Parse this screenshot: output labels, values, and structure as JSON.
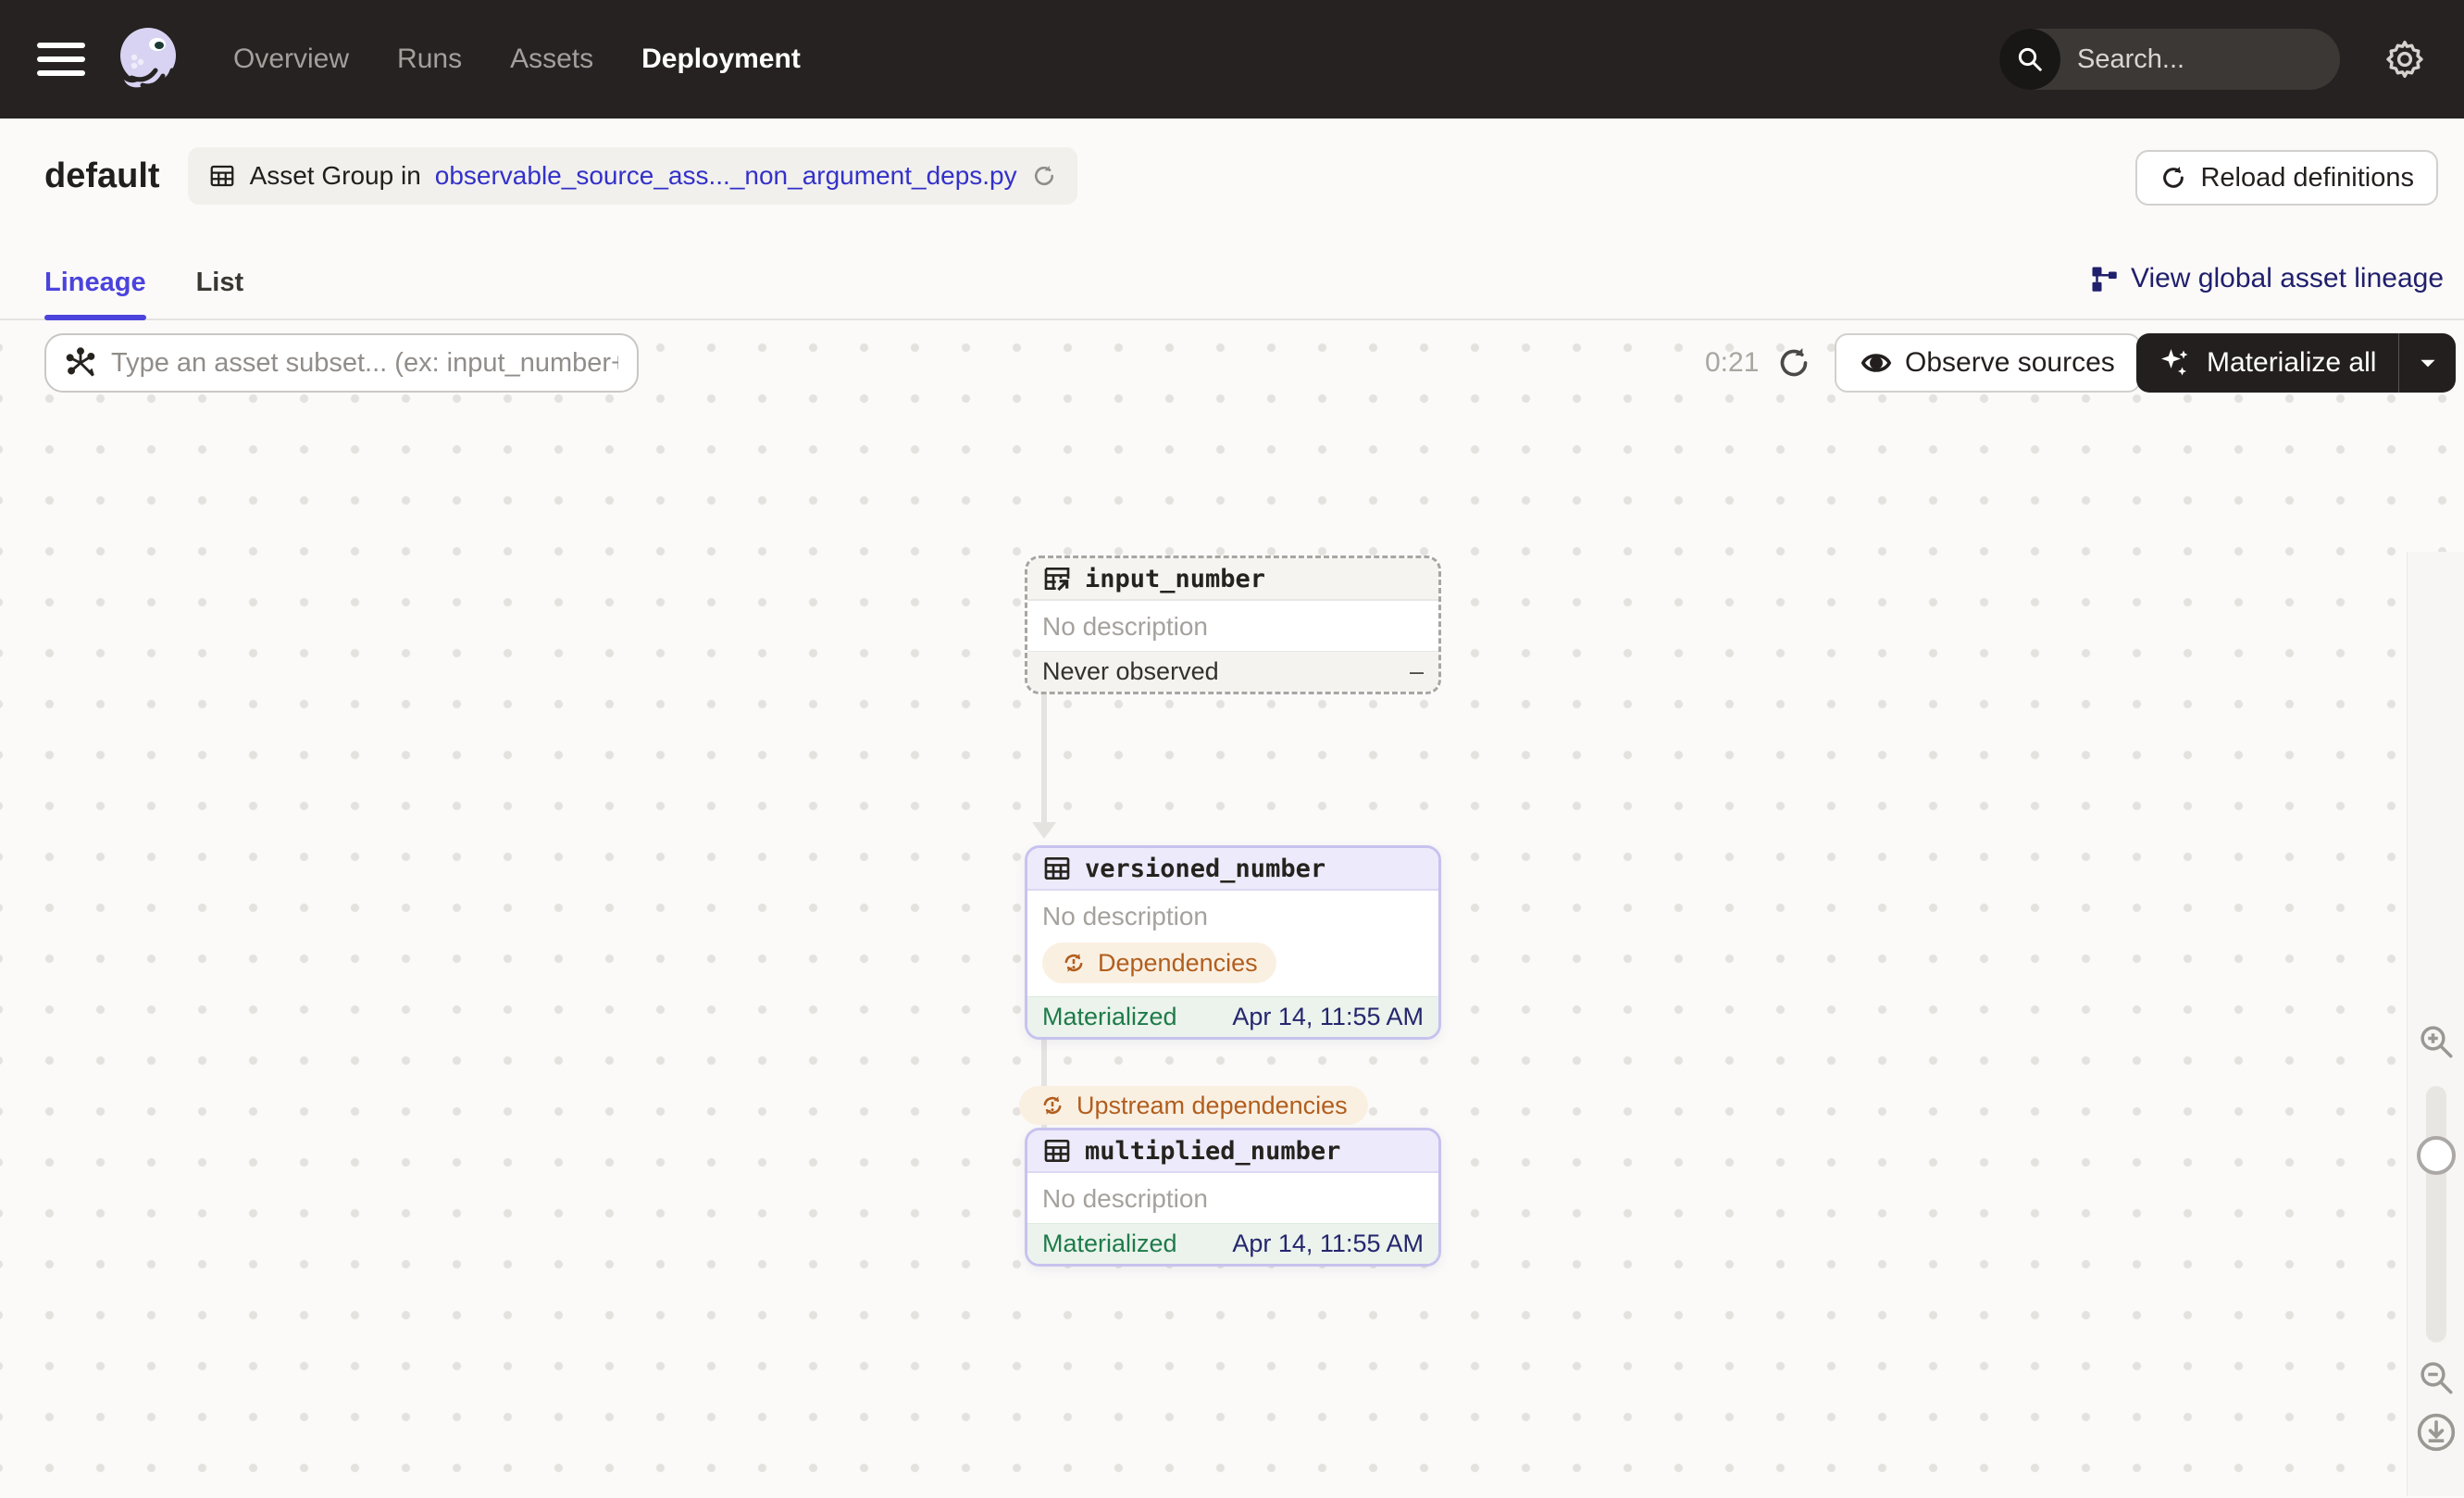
{
  "navbar": {
    "items": [
      {
        "label": "Overview",
        "active": false
      },
      {
        "label": "Runs",
        "active": false
      },
      {
        "label": "Assets",
        "active": false
      },
      {
        "label": "Deployment",
        "active": true
      }
    ],
    "search_placeholder": "Search...",
    "search_shortcut": "/"
  },
  "header": {
    "title": "default",
    "breadcrumb_prefix": "Asset Group in",
    "breadcrumb_link": "observable_source_ass..._non_argument_deps.py",
    "reload_definitions_label": "Reload definitions"
  },
  "tabs": {
    "lineage": "Lineage",
    "list": "List"
  },
  "global_lineage_label": "View global asset lineage",
  "toolbar": {
    "filter_placeholder": "Type an asset subset... (ex: input_number+",
    "timer": "0:21",
    "observe_sources_label": "Observe sources",
    "materialize_all_label": "Materialize all"
  },
  "graph": {
    "input_number": {
      "name": "input_number",
      "description": "No description",
      "status": "Never observed",
      "value": "–"
    },
    "versioned_number": {
      "name": "versioned_number",
      "description": "No description",
      "tag": "Dependencies",
      "status": "Materialized",
      "timestamp": "Apr 14, 11:55 AM"
    },
    "multiplied_number": {
      "name": "multiplied_number",
      "description": "No description",
      "status": "Materialized",
      "timestamp": "Apr 14, 11:55 AM"
    },
    "edge_tag": "Upstream dependencies"
  },
  "colors": {
    "accent_indigo": "#4B43DC",
    "breadcrumb_link_blue": "#3331C8",
    "dark_link_navy": "#201F6C",
    "materialized_green": "#1E7B49",
    "dependency_orange": "#B15E1E",
    "timestamp_navy": "#26266E",
    "navbar_bg": "#262221"
  }
}
